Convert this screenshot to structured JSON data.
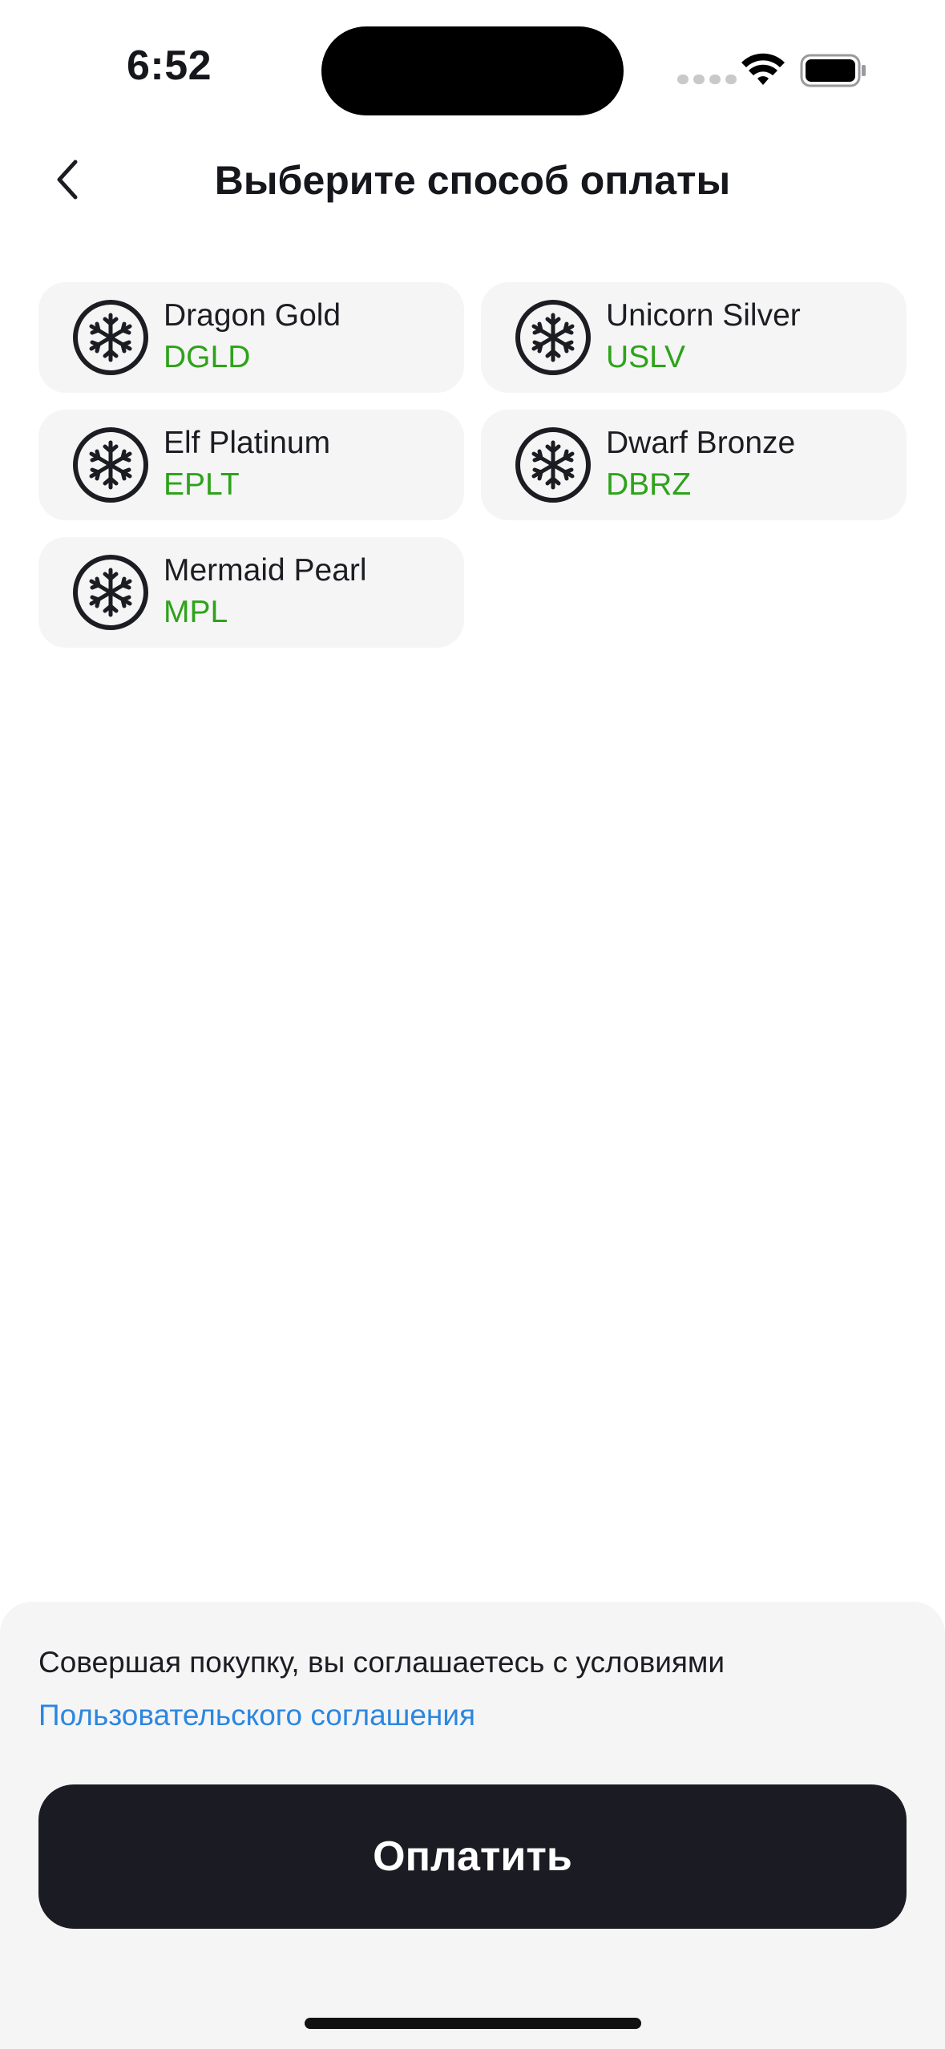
{
  "status_bar": {
    "time": "6:52"
  },
  "header": {
    "title": "Выберите способ оплаты",
    "back_icon": "chevron-left-icon"
  },
  "payment_methods": [
    {
      "name": "Dragon Gold",
      "code": "DGLD",
      "icon": "snowflake-coin-icon"
    },
    {
      "name": "Unicorn Silver",
      "code": "USLV",
      "icon": "snowflake-coin-icon"
    },
    {
      "name": "Elf Platinum",
      "code": "EPLT",
      "icon": "snowflake-coin-icon"
    },
    {
      "name": "Dwarf Bronze",
      "code": "DBRZ",
      "icon": "snowflake-coin-icon"
    },
    {
      "name": "Mermaid Pearl",
      "code": "MPL",
      "icon": "snowflake-coin-icon"
    }
  ],
  "footer": {
    "agreement_text": "Совершая покупку, вы соглашаетесь с условиями",
    "agreement_link": "Пользовательского соглашения",
    "pay_label": "Оплатить"
  },
  "colors": {
    "code_green": "#2ea31a",
    "link_blue": "#2b87e0",
    "button_dark": "#1b1b23",
    "card_bg": "#f5f5f6"
  }
}
